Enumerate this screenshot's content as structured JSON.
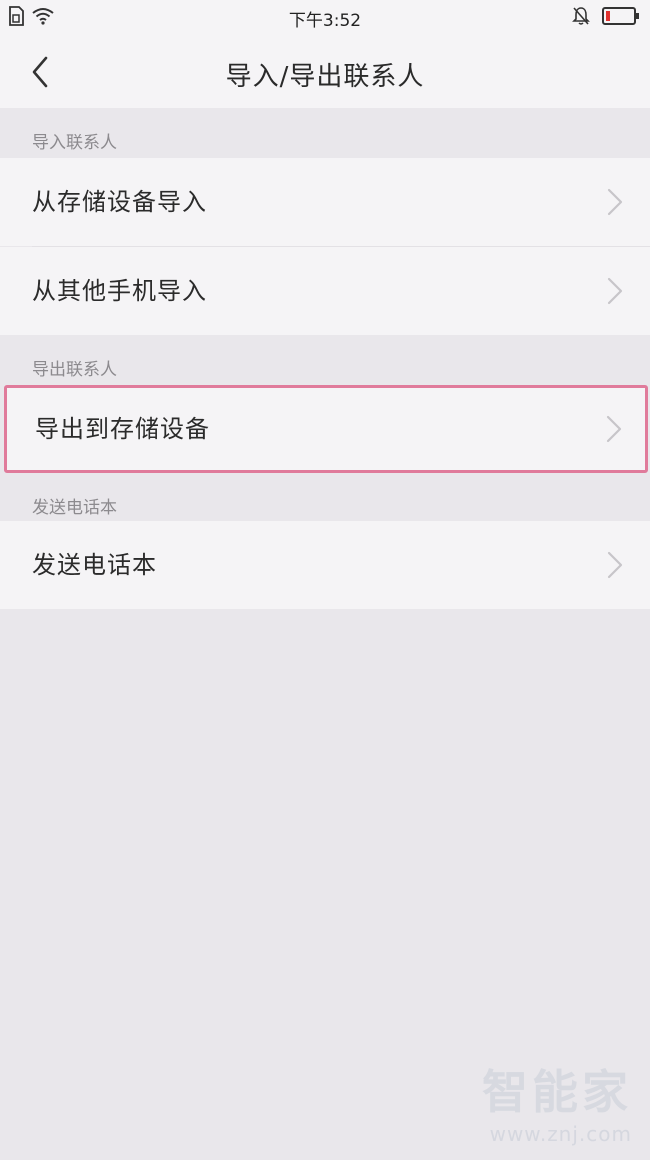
{
  "status_bar": {
    "time": "下午3:52"
  },
  "header": {
    "title": "导入/导出联系人"
  },
  "sections": [
    {
      "title": "导入联系人",
      "items": [
        {
          "label": "从存储设备导入"
        },
        {
          "label": "从其他手机导入"
        }
      ]
    },
    {
      "title": "导出联系人",
      "items": [
        {
          "label": "导出到存储设备"
        }
      ]
    },
    {
      "title": "发送电话本",
      "items": [
        {
          "label": "发送电话本"
        }
      ]
    }
  ],
  "watermark": {
    "brand": "智能家",
    "url": "www.znj.com"
  },
  "colors": {
    "highlight_border": "#e07b9b",
    "background": "#e9e7eb",
    "row_background": "#f5f4f6"
  },
  "icons": {
    "back": "chevron-left-icon",
    "row_arrow": "chevron-right-icon"
  }
}
